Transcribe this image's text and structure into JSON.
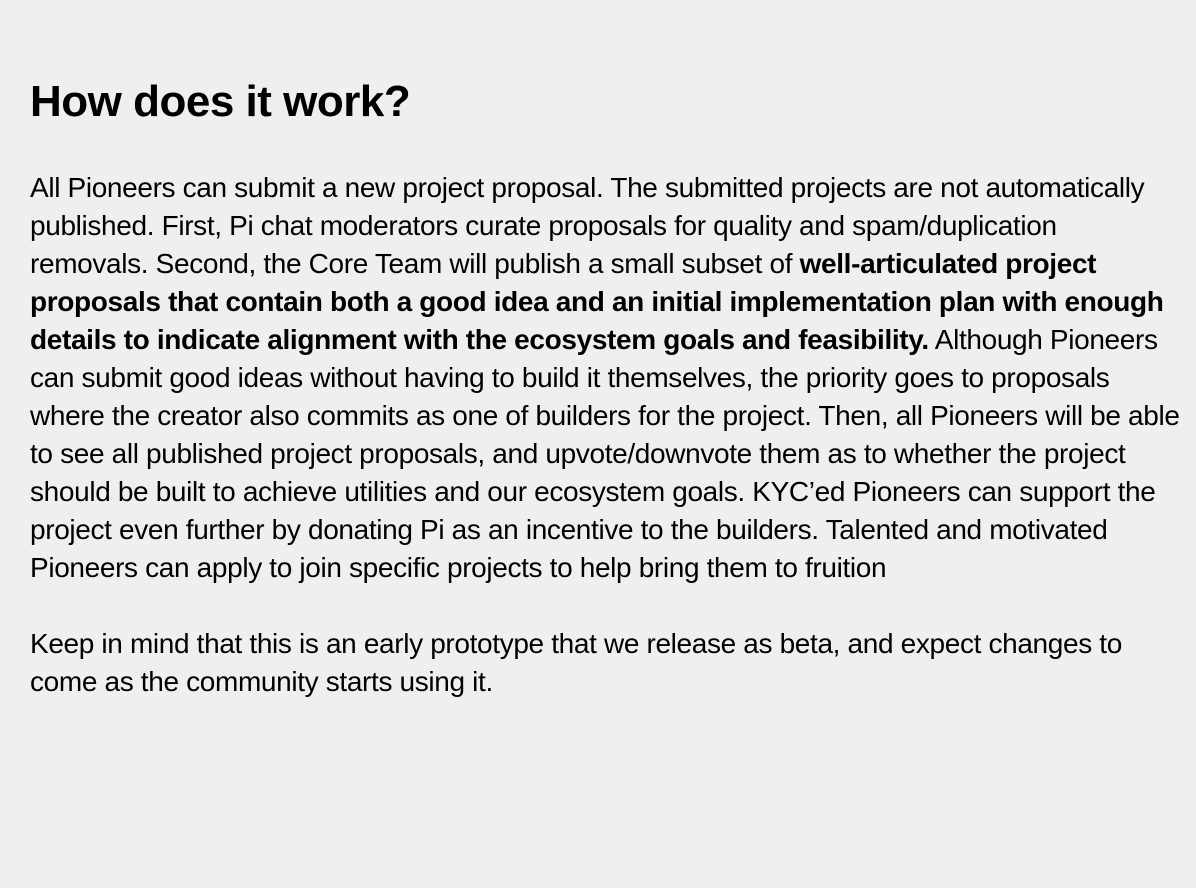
{
  "heading": "How does it work?",
  "paragraph1": {
    "before_bold": "All Pioneers can submit a new project proposal. The submitted projects are not automatically published. First, Pi chat moderators curate proposals for quality and spam/duplication removals. Second, the Core Team will publish a small subset of ",
    "bold": "well-articulated project proposals that contain both a good idea and an initial implementation plan with enough details to indicate alignment with the ecosystem goals and feasibility.",
    "after_bold": " Although Pioneers can submit good ideas without having to build it themselves, the priority goes to proposals where the creator also commits as one of builders for the project. Then, all Pioneers will be able to see all published project proposals, and upvote/downvote them as to whether the project should be built to achieve utilities and our ecosystem goals. KYC’ed Pioneers can support the project even further by donating Pi as an incentive to the builders. Talented and motivated Pioneers can apply to join specific projects to help bring them to fruition"
  },
  "paragraph2": "Keep in mind that this is an early prototype that we release as beta, and expect changes to come as the community starts using it."
}
